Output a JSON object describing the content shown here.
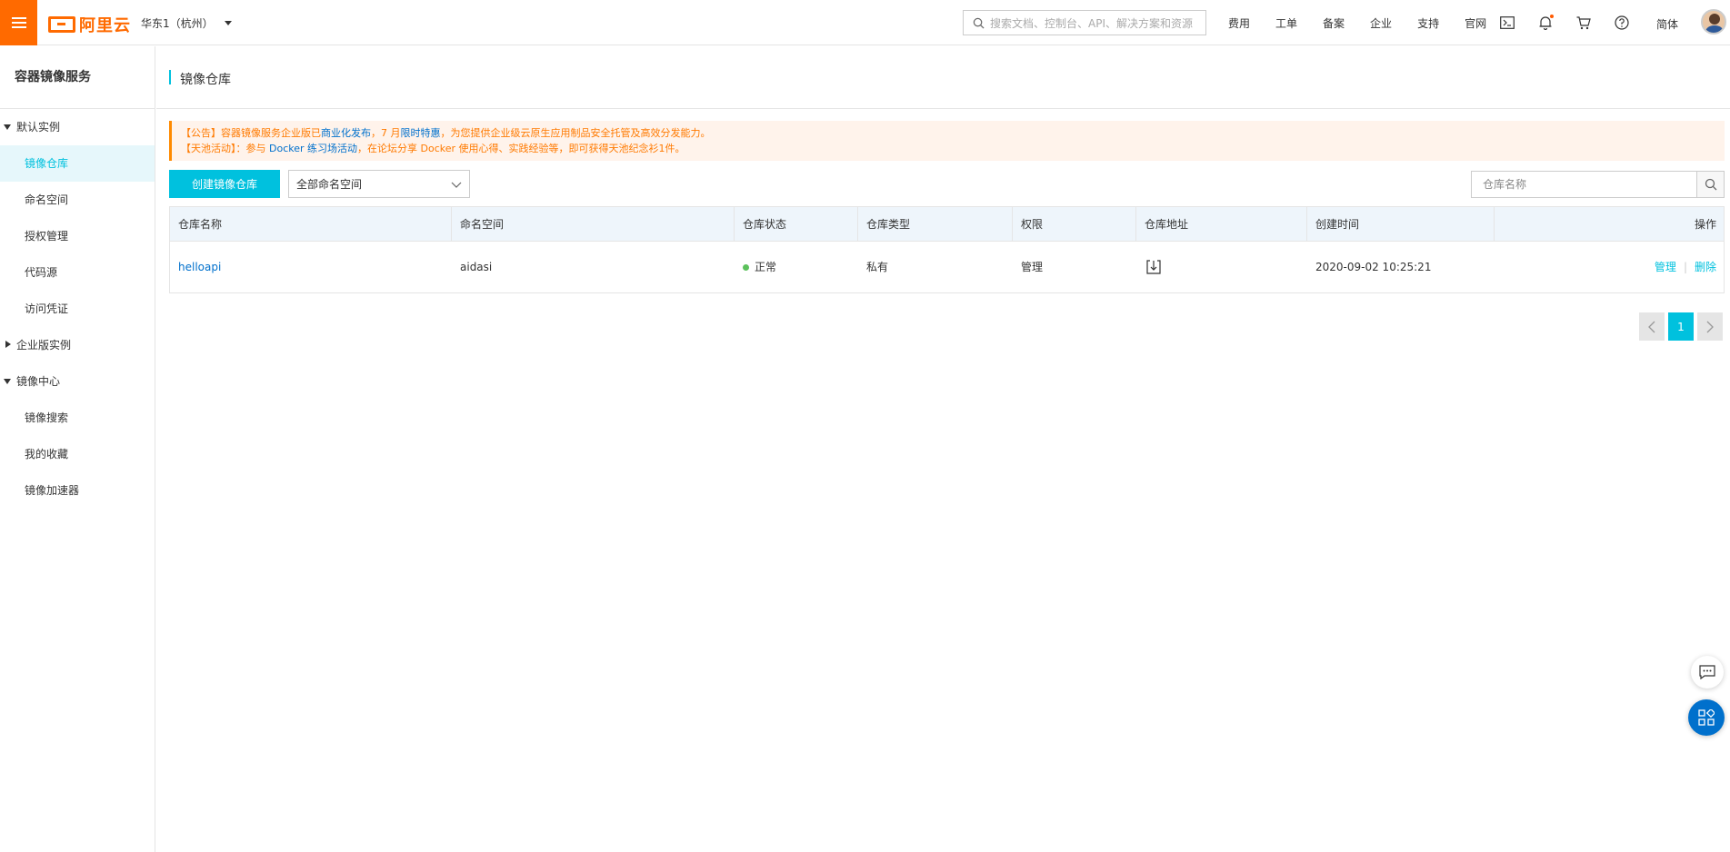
{
  "topbar": {
    "logo_text": "阿里云",
    "region": "华东1（杭州）",
    "search_placeholder": "搜索文档、控制台、API、解决方案和资源",
    "nav_links": [
      "费用",
      "工单",
      "备案",
      "企业",
      "支持",
      "官网"
    ],
    "icons": [
      "terminal-icon",
      "bell-icon",
      "cart-icon",
      "help-icon"
    ],
    "language": "简体"
  },
  "sidebar": {
    "title": "容器镜像服务",
    "groups": [
      {
        "label": "默认实例",
        "expanded": true,
        "items": [
          "镜像仓库",
          "命名空间",
          "授权管理",
          "代码源",
          "访问凭证"
        ]
      },
      {
        "label": "企业版实例",
        "expanded": false,
        "items": []
      },
      {
        "label": "镜像中心",
        "expanded": true,
        "items": [
          "镜像搜索",
          "我的收藏",
          "镜像加速器"
        ]
      }
    ],
    "active_item": "镜像仓库"
  },
  "page": {
    "title": "镜像仓库"
  },
  "notice": {
    "line1_a": "【公告】容器镜像服务企业版已",
    "line1_link1": "商业化发布",
    "line1_b": "，7 月",
    "line1_link2": "限时特惠",
    "line1_c": "，为您提供企业级云原生应用制品安全托管及高效分发能力。",
    "line2_a": "【天池活动】：参与 ",
    "line2_link": "Docker 练习场活动",
    "line2_b": "，在论坛分享 Docker 使用心得、实践经验等，即可获得天池纪念衫1件。"
  },
  "toolbar": {
    "create_button": "创建镜像仓库",
    "namespace_select": "全部命名空间",
    "search_placeholder": "仓库名称"
  },
  "table": {
    "headers": [
      "仓库名称",
      "命名空间",
      "仓库状态",
      "仓库类型",
      "权限",
      "仓库地址",
      "创建时间",
      "操作"
    ],
    "rows": [
      {
        "name": "helloapi",
        "namespace": "aidasi",
        "status": "正常",
        "type": "私有",
        "permission": "管理",
        "created": "2020-09-02 10:25:21",
        "op_manage": "管理",
        "op_separator": "|",
        "op_delete": "删除"
      }
    ]
  },
  "pagination": {
    "current_page": "1"
  },
  "colors": {
    "brand": "#ff6a00",
    "accent": "#00c1de",
    "link": "#0070cc",
    "notice_text": "#ff7a00",
    "status_ok": "#5cc15c"
  }
}
